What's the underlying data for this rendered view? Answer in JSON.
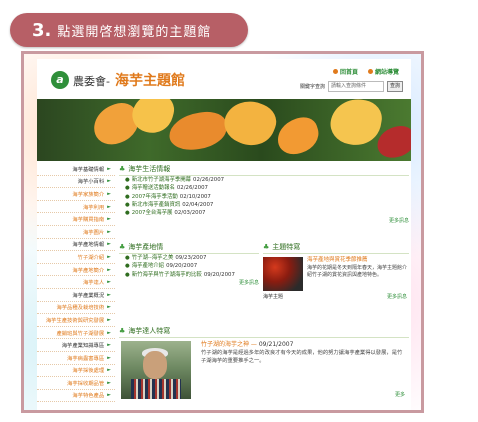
{
  "step": {
    "number": "3.",
    "text": "點選開啓想瀏覽的主題館"
  },
  "site": {
    "brand_prefix": "農委會-",
    "brand_title": "海芋主題館",
    "logo_letter": "a",
    "top_links": [
      "回首頁",
      "網站導覽"
    ],
    "search_label": "關鍵字查詢",
    "search_placeholder": "請輸入查詢條件",
    "search_button": "查詢"
  },
  "sidebar": {
    "items": [
      {
        "label": "海芋基礎情報",
        "kind": "head"
      },
      {
        "label": "海芋小百科",
        "kind": "head"
      },
      {
        "label": "海芋家族簡介",
        "kind": "link"
      },
      {
        "label": "海芋利用",
        "kind": "link"
      },
      {
        "label": "海芋購買指南",
        "kind": "link"
      },
      {
        "label": "海芋圖片",
        "kind": "link"
      },
      {
        "label": "海芋產地情報",
        "kind": "head"
      },
      {
        "label": "竹子湖介紹",
        "kind": "link"
      },
      {
        "label": "海芋產地簡介",
        "kind": "link"
      },
      {
        "label": "海芋達人",
        "kind": "link"
      },
      {
        "label": "海芋產業概況",
        "kind": "head"
      },
      {
        "label": "海芋品種及栽培技術",
        "kind": "link"
      },
      {
        "label": "海芋生產技術與研究發展",
        "kind": "link"
      },
      {
        "label": "產銷班與竹子湖發展",
        "kind": "link"
      },
      {
        "label": "海芋產業知識專區",
        "kind": "head"
      },
      {
        "label": "海芋病蟲害專區",
        "kind": "link"
      },
      {
        "label": "海芋採後處理",
        "kind": "link"
      },
      {
        "label": "海芋採收期品管",
        "kind": "link"
      },
      {
        "label": "海芋特色產品",
        "kind": "link"
      }
    ]
  },
  "main": {
    "news": {
      "title": "海芋生活情報",
      "items": [
        {
          "text": "新北市竹子湖海芋季開幕",
          "date": "02/26/2007"
        },
        {
          "text": "海芋贈送活動報名",
          "date": "02/26/2007"
        },
        {
          "text": "2007年海芋季活動",
          "date": "02/10/2007"
        },
        {
          "text": "新北市海芋產銷資訊",
          "date": "02/04/2007"
        },
        {
          "text": "2007全台海芋展",
          "date": "02/03/2007"
        }
      ],
      "more": "更多訊息"
    },
    "farm": {
      "title": "海芋產地情",
      "items": [
        {
          "text": "竹子湖--海芋之美",
          "date": "09/23/2007"
        },
        {
          "text": "海芋產地介紹",
          "date": "09/20/2007"
        },
        {
          "text": "新竹海芋與竹子湖海芋的比較",
          "date": "09/20/2007"
        }
      ],
      "more": "更多訊息"
    },
    "promo": {
      "title": "主題特寫",
      "headline": "海芋產地與賞花季節推薦",
      "text": "海芋的花期是冬天到隔年春天，海芋主題館介紹竹子湖的賞花資訊與產地特色。",
      "caption": "海芋主題",
      "more": "更多訊息"
    },
    "people": {
      "title": "海芋達人特寫",
      "headline": "竹子湖的海芋之神",
      "date": "09/21/2007",
      "text": "竹子湖的海芋是經過多年的改良才有今天的成果，他的努力讓海芋產業得以發展，是竹子湖海芋的重要推手之一。",
      "more": "更多"
    }
  }
}
